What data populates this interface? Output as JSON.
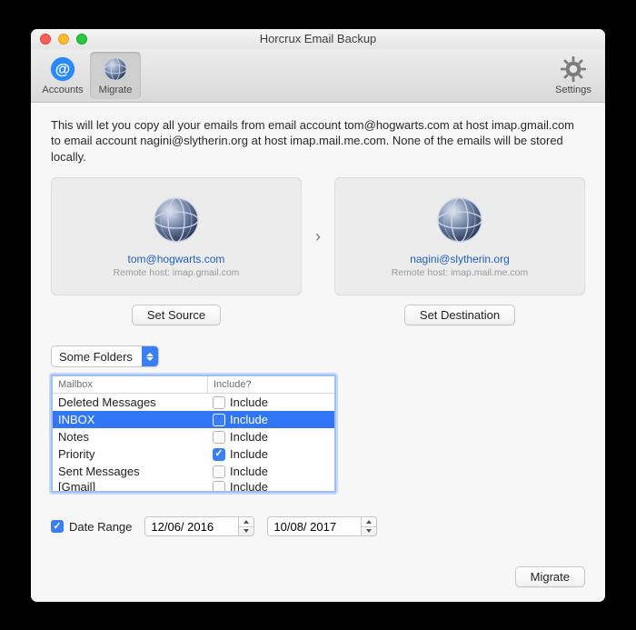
{
  "window": {
    "title": "Horcrux Email Backup"
  },
  "toolbar": {
    "accounts": "Accounts",
    "migrate": "Migrate",
    "settings": "Settings"
  },
  "intro": "This will let you copy all your emails from email account tom@hogwarts.com at host imap.gmail.com to email account nagini@slytherin.org at host imap.mail.me.com. None of the emails will be stored locally.",
  "accounts": {
    "source": {
      "email": "tom@hogwarts.com",
      "host_line": "Remote host: imap.gmail.com",
      "set_button": "Set Source"
    },
    "destination": {
      "email": "nagini@slytherin.org",
      "host_line": "Remote host: imap.mail.me.com",
      "set_button": "Set Destination"
    }
  },
  "folder_scope": {
    "selected": "Some Folders"
  },
  "folder_table": {
    "headers": {
      "mailbox": "Mailbox",
      "include": "Include?"
    },
    "include_label": "Include",
    "rows": [
      {
        "mailbox": "Deleted Messages",
        "checked": false,
        "selected": false
      },
      {
        "mailbox": "INBOX",
        "checked": true,
        "selected": true
      },
      {
        "mailbox": "Notes",
        "checked": false,
        "selected": false
      },
      {
        "mailbox": "Priority",
        "checked": true,
        "selected": false
      },
      {
        "mailbox": "Sent Messages",
        "checked": false,
        "selected": false
      },
      {
        "mailbox": "[Gmail]",
        "checked": false,
        "selected": false,
        "clipped": true
      }
    ]
  },
  "date_range": {
    "checked": true,
    "label": "Date Range",
    "from": "12/06/ 2016",
    "to": "10/08/ 2017"
  },
  "footer": {
    "migrate": "Migrate"
  }
}
